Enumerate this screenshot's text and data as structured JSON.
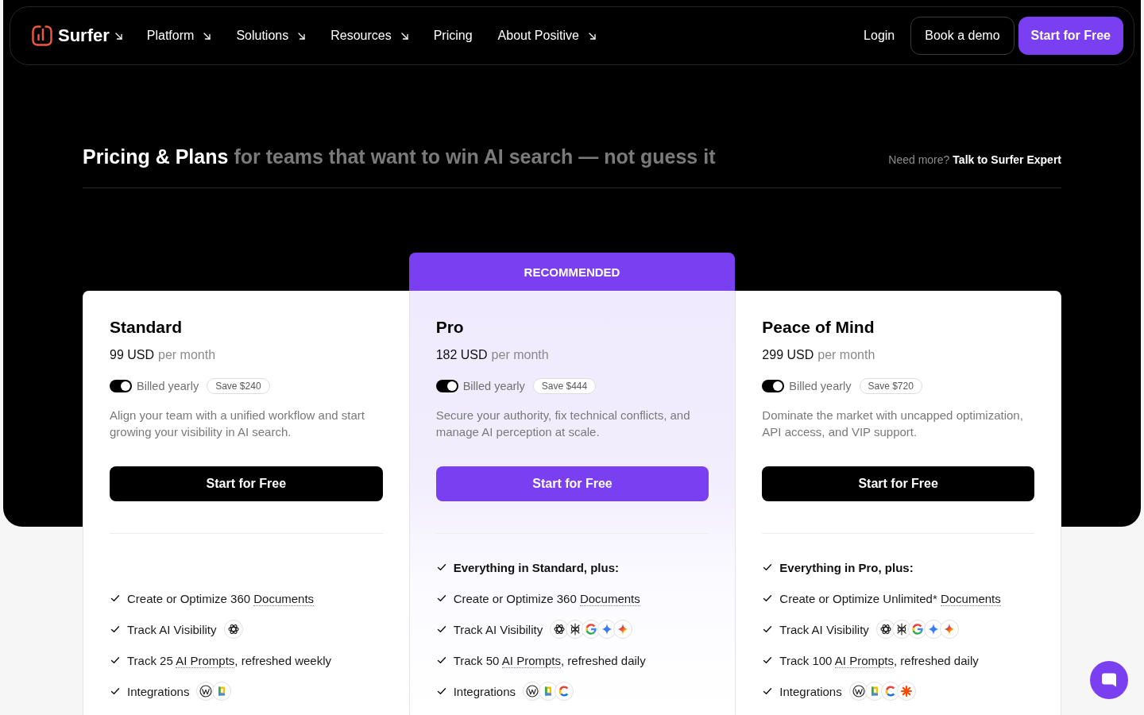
{
  "nav": {
    "brand": {
      "label": "Surfer",
      "dropdown": true
    },
    "links": [
      {
        "label": "Platform",
        "dropdown": true
      },
      {
        "label": "Solutions",
        "dropdown": true
      },
      {
        "label": "Resources",
        "dropdown": true
      },
      {
        "label": "Pricing",
        "dropdown": false
      },
      {
        "label": "About Positive",
        "dropdown": true
      }
    ],
    "actions": [
      {
        "label": "Login",
        "kind": "text"
      },
      {
        "label": "Book a demo",
        "kind": "outline"
      },
      {
        "label": "Start for Free",
        "kind": "primary"
      }
    ]
  },
  "header": {
    "title": "Pricing & Plans",
    "tagline": "for teams that want to win AI search — not guess it",
    "help_text": "Need more?",
    "help_link": "Talk to Surfer Expert"
  },
  "plans": [
    {
      "name": "Standard",
      "featured": false,
      "price": "99 USD",
      "period": "per month",
      "billing": {
        "label": "Billed yearly",
        "on": true
      },
      "savings": "Save $240",
      "description": "Align your team with a unified workflow and start growing your visibility in AI search.",
      "cta": "Start for Free",
      "features": [
        {
          "parts": [
            {
              "text": "Create or Optimize 360 ",
              "term": false
            },
            {
              "text": "Documents",
              "term": true
            }
          ]
        },
        {
          "parts": [
            {
              "text": "Track AI Visibility",
              "term": false
            }
          ],
          "icons": [
            {
              "kind": "rosette"
            }
          ]
        },
        {
          "parts": [
            {
              "text": "Track 25 ",
              "term": false
            },
            {
              "text": "AI Prompts",
              "term": true
            },
            {
              "text": ", refreshed weekly",
              "term": false
            }
          ]
        },
        {
          "parts": [
            {
              "text": "Integrations",
              "term": false
            }
          ],
          "icons": [
            {
              "kind": "w"
            },
            {
              "kind": "doc"
            }
          ]
        }
      ]
    },
    {
      "name": "Pro",
      "badge": "RECOMMENDED",
      "featured": true,
      "price": "182 USD",
      "period": "per month",
      "billing": {
        "label": "Billed yearly",
        "on": true
      },
      "savings": "Save $444",
      "description": "Secure your authority, fix technical conflicts, and manage AI perception at scale.",
      "cta": "Start for Free",
      "includes": "Everything in Standard, plus:",
      "features": [
        {
          "parts": [
            {
              "text": "Create or Optimize 360 ",
              "term": false
            },
            {
              "text": "Documents",
              "term": true
            }
          ]
        },
        {
          "parts": [
            {
              "text": "Track AI Visibility",
              "term": false
            }
          ],
          "icons": [
            {
              "kind": "rosette"
            },
            {
              "kind": "snowflake"
            },
            {
              "kind": "g"
            },
            {
              "kind": "star"
            },
            {
              "kind": "sparkle"
            }
          ]
        },
        {
          "parts": [
            {
              "text": "Track 50 ",
              "term": false
            },
            {
              "text": "AI Prompts",
              "term": true
            },
            {
              "text": ", refreshed daily",
              "term": false
            }
          ]
        },
        {
          "parts": [
            {
              "text": "Integrations",
              "term": false
            }
          ],
          "icons": [
            {
              "kind": "w"
            },
            {
              "kind": "doc"
            },
            {
              "kind": "c"
            }
          ]
        }
      ]
    },
    {
      "name": "Peace of Mind",
      "featured": false,
      "price": "299 USD",
      "period": "per month",
      "billing": {
        "label": "Billed yearly",
        "on": true
      },
      "savings": "Save $720",
      "description": "Dominate the market with uncapped optimization, API access, and VIP support.",
      "cta": "Start for Free",
      "includes": "Everything in Pro, plus:",
      "features": [
        {
          "parts": [
            {
              "text": "Create or Optimize Unlimited* ",
              "term": false
            },
            {
              "text": "Documents",
              "term": true
            }
          ]
        },
        {
          "parts": [
            {
              "text": "Track AI Visibility",
              "term": false
            }
          ],
          "icons": [
            {
              "kind": "rosette"
            },
            {
              "kind": "snowflake"
            },
            {
              "kind": "g"
            },
            {
              "kind": "star"
            },
            {
              "kind": "sparkle"
            }
          ]
        },
        {
          "parts": [
            {
              "text": "Track 100 ",
              "term": false
            },
            {
              "text": "AI Prompts",
              "term": true
            },
            {
              "text": ", refreshed daily",
              "term": false
            }
          ]
        },
        {
          "parts": [
            {
              "text": "Integrations",
              "term": false
            }
          ],
          "icons": [
            {
              "kind": "w"
            },
            {
              "kind": "doc"
            },
            {
              "kind": "c"
            },
            {
              "kind": "asterisk"
            }
          ]
        }
      ]
    }
  ]
}
